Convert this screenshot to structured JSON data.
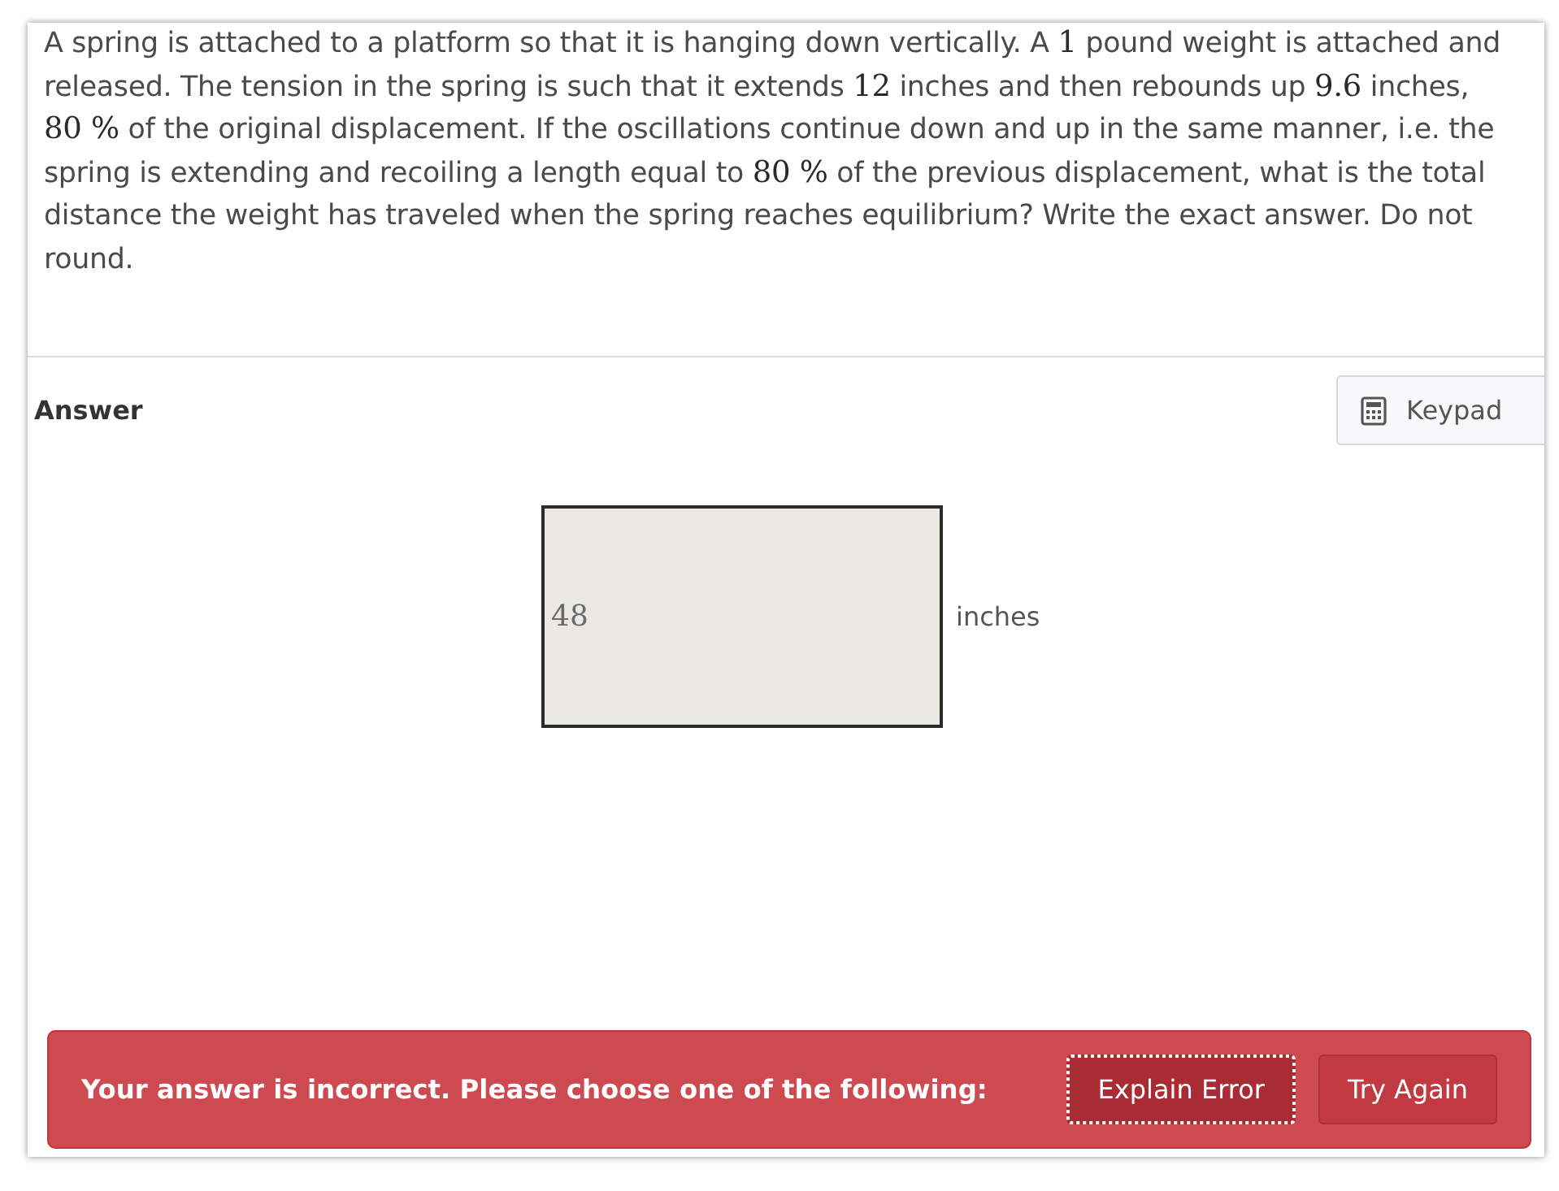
{
  "question": {
    "parts": [
      {
        "kind": "text",
        "text": "A spring is attached to a platform so that it is hanging down vertically. A "
      },
      {
        "kind": "math",
        "text": "1"
      },
      {
        "kind": "text",
        "text": " pound weight is attached and released. The tension in the spring is such that it extends "
      },
      {
        "kind": "math",
        "text": "12"
      },
      {
        "kind": "text",
        "text": " inches and then rebounds up "
      },
      {
        "kind": "math",
        "text": "9.6"
      },
      {
        "kind": "text",
        "text": " inches, "
      },
      {
        "kind": "math",
        "text": "80 %"
      },
      {
        "kind": "text",
        "text": " of the original displacement. If the oscillations continue down and up in the same manner, i.e. the spring is extending and recoiling a length equal to "
      },
      {
        "kind": "math",
        "text": "80 %"
      },
      {
        "kind": "text",
        "text": " of the previous displacement, what is the total distance the weight has traveled when the spring reaches equilibrium? Write the exact answer. Do not round."
      }
    ]
  },
  "answer": {
    "heading": "Answer",
    "keypad_button": "Keypad",
    "value": "48",
    "unit": "inches"
  },
  "feedback": {
    "message": "Your answer is incorrect. Please choose one of the following:",
    "buttons": [
      {
        "label": "Explain Error",
        "focused": true
      },
      {
        "label": "Try Again",
        "focused": false
      }
    ]
  }
}
